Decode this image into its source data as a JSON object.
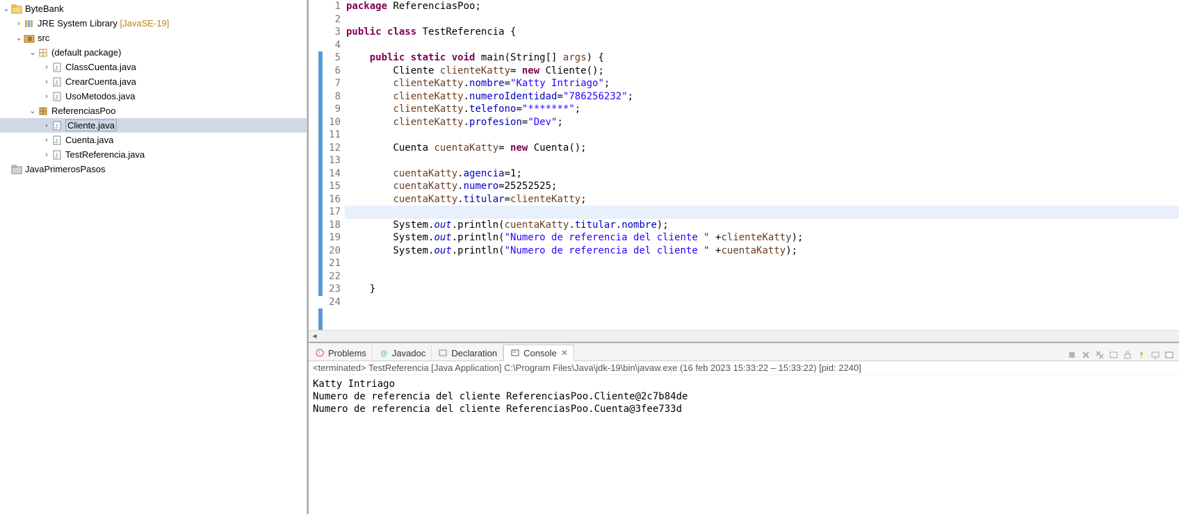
{
  "explorer": {
    "project": "ByteBank",
    "jre": {
      "label": "JRE System Library",
      "tag": "[JavaSE-19]"
    },
    "src": "src",
    "defaultPkg": "(default package)",
    "files_default": [
      "ClassCuenta.java",
      "CrearCuenta.java",
      "UsoMetodos.java"
    ],
    "pkg_ref": "ReferenciasPoo",
    "files_ref": [
      "Cliente.java",
      "Cuenta.java",
      "TestReferencia.java"
    ],
    "otherProject": "JavaPrimerosPasos"
  },
  "editor": {
    "lines": [
      1,
      2,
      3,
      4,
      5,
      6,
      7,
      8,
      9,
      10,
      11,
      12,
      13,
      14,
      15,
      16,
      17,
      18,
      19,
      20,
      21,
      22,
      23,
      24
    ],
    "blueLines": [
      5,
      6,
      7,
      8,
      9,
      10,
      11,
      12,
      13,
      14,
      15,
      16,
      17,
      18,
      19,
      20,
      21,
      22,
      23
    ],
    "highlightLine": 17,
    "code": {
      "l1_kw1": "package",
      "l1_rest": " ReferenciasPoo;",
      "l3_kw1": "public",
      "l3_kw2": "class",
      "l3_rest": " TestReferencia {",
      "l5_kw1": "public",
      "l5_kw2": "static",
      "l5_kw3": "void",
      "l5_main": " main(String[] ",
      "l5_args": "args",
      "l5_end": ") {",
      "l6_a": "        Cliente ",
      "l6_b": "clienteKatty",
      "l6_c": "= ",
      "l6_kw": "new",
      "l6_d": " Cliente();",
      "l7_a": "        ",
      "l7_b": "clienteKatty",
      "l7_c": ".",
      "l7_d": "nombre",
      "l7_e": "=",
      "l7_f": "\"Katty Intriago\"",
      "l7_g": ";",
      "l8_a": "        ",
      "l8_b": "clienteKatty",
      "l8_c": ".",
      "l8_d": "numeroIdentidad",
      "l8_e": "=",
      "l8_f": "\"786256232\"",
      "l8_g": ";",
      "l9_a": "        ",
      "l9_b": "clienteKatty",
      "l9_c": ".",
      "l9_d": "telefono",
      "l9_e": "=",
      "l9_f": "\"*******\"",
      "l9_g": ";",
      "l10_a": "        ",
      "l10_b": "clienteKatty",
      "l10_c": ".",
      "l10_d": "profesion",
      "l10_e": "=",
      "l10_f": "\"Dev\"",
      "l10_g": ";",
      "l12_a": "        Cuenta ",
      "l12_b": "cuentaKatty",
      "l12_c": "= ",
      "l12_kw": "new",
      "l12_d": " Cuenta();",
      "l14_a": "        ",
      "l14_b": "cuentaKatty",
      "l14_c": ".",
      "l14_d": "agencia",
      "l14_e": "=1;",
      "l15_a": "        ",
      "l15_b": "cuentaKatty",
      "l15_c": ".",
      "l15_d": "numero",
      "l15_e": "=25252525;",
      "l16_a": "        ",
      "l16_b": "cuentaKatty",
      "l16_c": ".",
      "l16_d": "titular",
      "l16_e": "=",
      "l16_f": "clienteKatty",
      "l16_g": ";",
      "l17_a": "        ",
      "l18_a": "        System.",
      "l18_b": "out",
      "l18_c": ".println(",
      "l18_d": "cuentaKatty",
      "l18_e": ".",
      "l18_f": "titular",
      "l18_g": ".",
      "l18_h": "nombre",
      "l18_i": ");",
      "l19_a": "        System.",
      "l19_b": "out",
      "l19_c": ".println(",
      "l19_d": "\"Numero de referencia del cliente \"",
      "l19_e": " +",
      "l19_f": "clienteKatty",
      "l19_g": ");",
      "l20_a": "        System.",
      "l20_b": "out",
      "l20_c": ".println(",
      "l20_d": "\"Numero de referencia del cliente \"",
      "l20_e": " +",
      "l20_f": "cuentaKatty",
      "l20_g": ");",
      "l23_a": "    }"
    }
  },
  "bottom": {
    "tabs": {
      "problems": "Problems",
      "javadoc": "Javadoc",
      "declaration": "Declaration",
      "console": "Console"
    },
    "console_header": "<terminated> TestReferencia [Java Application] C:\\Program Files\\Java\\jdk-19\\bin\\javaw.exe  (16 feb 2023 15:33:22 – 15:33:22) [pid: 2240]",
    "console_output": "Katty Intriago\nNumero de referencia del cliente ReferenciasPoo.Cliente@2c7b84de\nNumero de referencia del cliente ReferenciasPoo.Cuenta@3fee733d"
  }
}
